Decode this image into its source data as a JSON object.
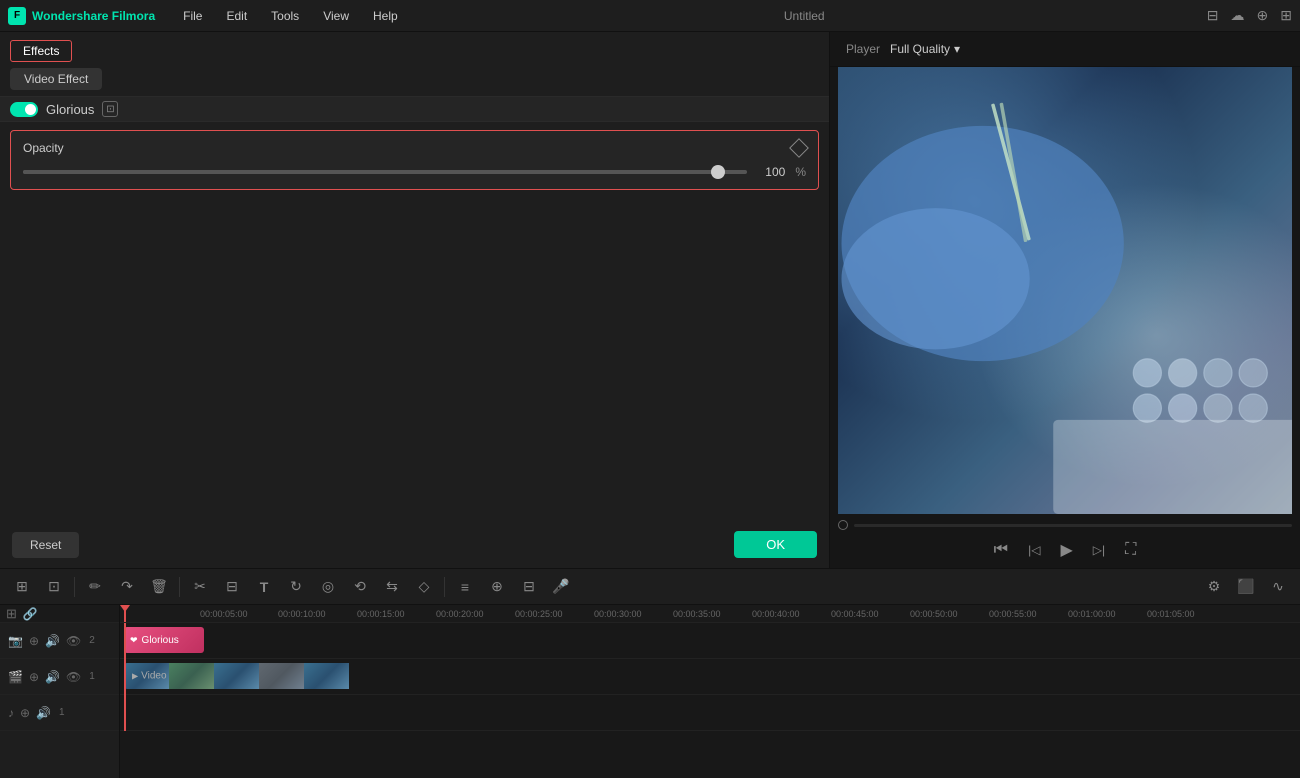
{
  "app": {
    "name": "Wondershare Filmora",
    "title": "Untitled"
  },
  "menubar": {
    "file": "File",
    "edit": "Edit",
    "tools": "Tools",
    "view": "View",
    "help": "Help"
  },
  "leftPanel": {
    "effectsTab": "Effects",
    "videoEffectTab": "Video Effect",
    "gloriousLabel": "Glorious",
    "opacityLabel": "Opacity",
    "opacityValue": "100",
    "opacityUnit": "%",
    "resetLabel": "Reset",
    "okLabel": "OK"
  },
  "rightPanel": {
    "playerLabel": "Player",
    "qualityLabel": "Full Quality"
  },
  "toolbar": {
    "tools": [
      {
        "name": "scene-detect",
        "icon": "⊞"
      },
      {
        "name": "magnetic-snap",
        "icon": "⊡"
      },
      {
        "name": "pencil",
        "icon": "✏"
      },
      {
        "name": "redo",
        "icon": "↷"
      },
      {
        "name": "delete",
        "icon": "🗑"
      },
      {
        "name": "cut",
        "icon": "✂"
      },
      {
        "name": "crop",
        "icon": "⊞"
      },
      {
        "name": "text",
        "icon": "T"
      },
      {
        "name": "loop",
        "icon": "↻"
      },
      {
        "name": "speed",
        "icon": "◎"
      },
      {
        "name": "rotate",
        "icon": "⟲"
      },
      {
        "name": "flip",
        "icon": "⇆"
      },
      {
        "name": "mask",
        "icon": "◇"
      },
      {
        "name": "audio",
        "icon": "♪"
      },
      {
        "name": "equalize",
        "icon": "≡"
      },
      {
        "name": "merge",
        "icon": "⊕"
      },
      {
        "name": "frame",
        "icon": "⊟"
      },
      {
        "name": "voice",
        "icon": "🎤"
      },
      {
        "name": "wave",
        "icon": "∿"
      }
    ]
  },
  "timeline": {
    "timeMarks": [
      "00:00:05:00",
      "00:00:10:00",
      "00:00:15:00",
      "00:00:20:00",
      "00:00:25:00",
      "00:00:30:00",
      "00:00:35:00",
      "00:00:40:00",
      "00:00:45:00",
      "00:00:50:00",
      "00:00:55:00",
      "00:01:00:00",
      "00:01:05:00"
    ],
    "tracks": [
      {
        "type": "effect",
        "number": "2",
        "clipLabel": "Glorious"
      },
      {
        "type": "video",
        "number": "1",
        "clipLabel": "Video"
      },
      {
        "type": "audio",
        "number": "1"
      }
    ]
  },
  "icons": {
    "logo": "F",
    "chevron_down": "▾",
    "diamond": "◇",
    "play": "▶",
    "step_back": "⏮",
    "step_fwd": "⏭",
    "frame_fwd": "▷|",
    "fullscreen": "⛶",
    "settings": "⚙",
    "render": "⬛",
    "sound": "🔊",
    "lock": "🔒",
    "eye": "👁",
    "camera": "📷",
    "link": "🔗"
  }
}
